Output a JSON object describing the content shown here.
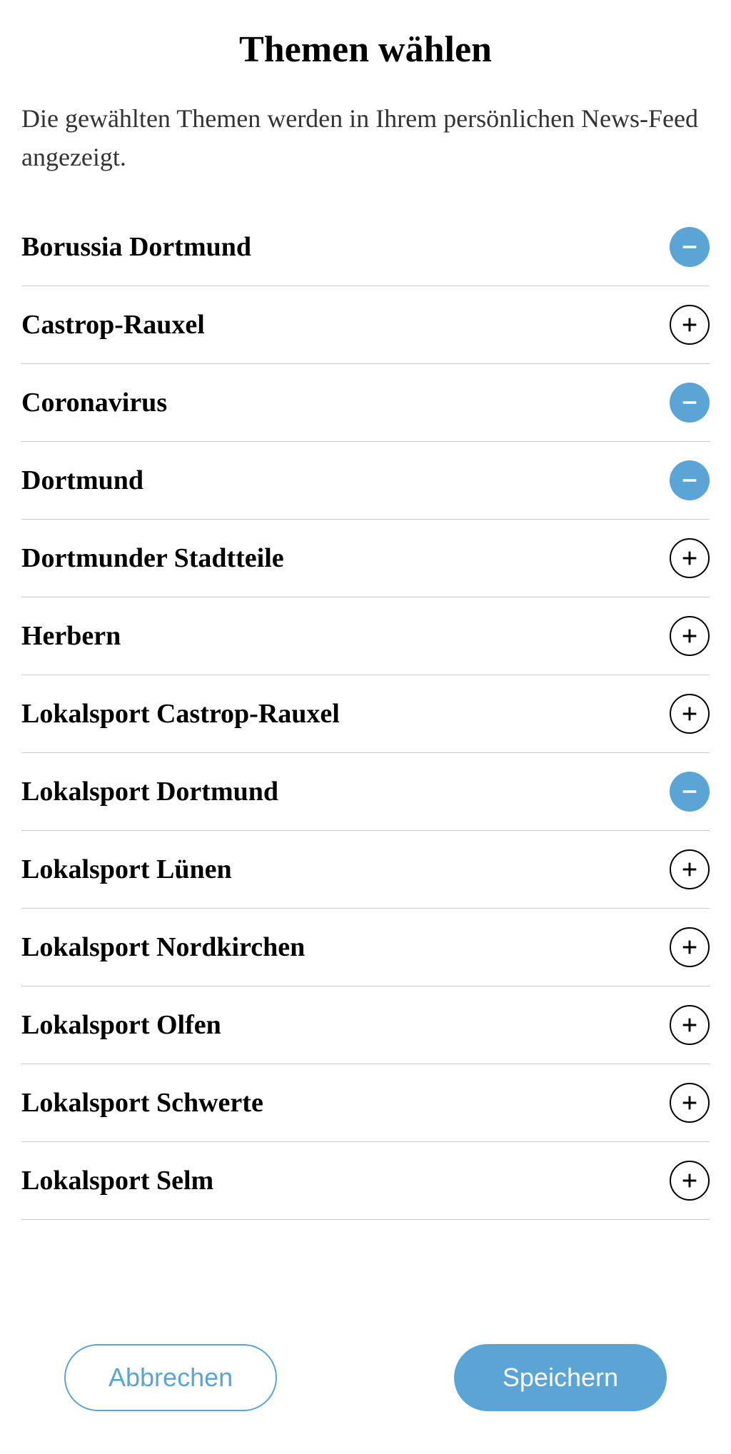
{
  "title": "Themen wählen",
  "description": "Die gewählten Themen werden in Ihrem persönlichen News-Feed angezeigt.",
  "topics": [
    {
      "label": "Borussia Dortmund",
      "selected": true
    },
    {
      "label": "Castrop-Rauxel",
      "selected": false
    },
    {
      "label": "Coronavirus",
      "selected": true
    },
    {
      "label": "Dortmund",
      "selected": true
    },
    {
      "label": "Dortmunder Stadtteile",
      "selected": false
    },
    {
      "label": "Herbern",
      "selected": false
    },
    {
      "label": "Lokalsport Castrop-Rauxel",
      "selected": false
    },
    {
      "label": "Lokalsport Dortmund",
      "selected": true
    },
    {
      "label": "Lokalsport Lünen",
      "selected": false
    },
    {
      "label": "Lokalsport Nordkirchen",
      "selected": false
    },
    {
      "label": "Lokalsport Olfen",
      "selected": false
    },
    {
      "label": "Lokalsport Schwerte",
      "selected": false
    },
    {
      "label": "Lokalsport Selm",
      "selected": false
    }
  ],
  "buttons": {
    "cancel": "Abbrechen",
    "save": "Speichern"
  },
  "colors": {
    "accent": "#5aa5d6"
  }
}
